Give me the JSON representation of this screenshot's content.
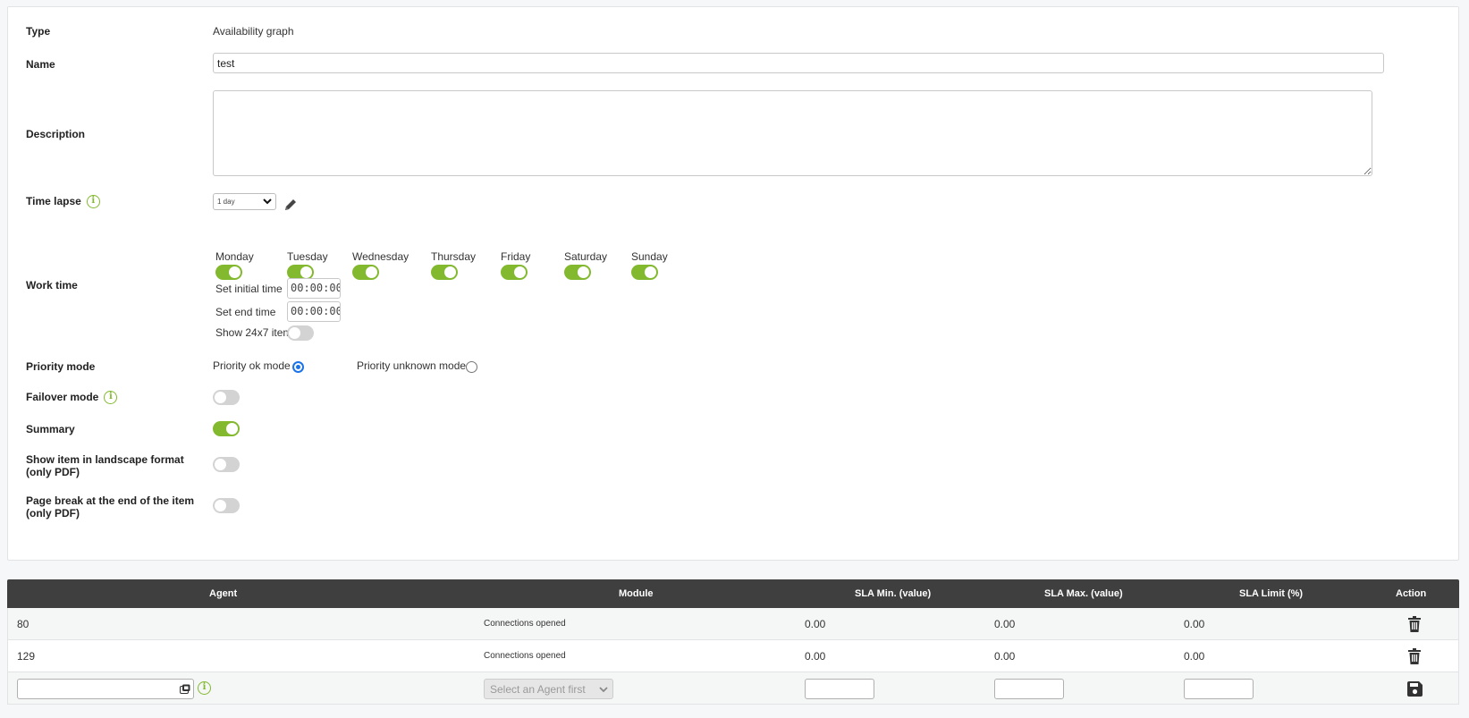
{
  "form": {
    "type_label": "Type",
    "type_value": "Availability graph",
    "name_label": "Name",
    "name_value": "test",
    "description_label": "Description",
    "description_value": "",
    "time_lapse_label": "Time lapse",
    "time_lapse_value": "1 day",
    "work_time_label": "Work time",
    "days": [
      {
        "name": "Monday",
        "on": true
      },
      {
        "name": "Tuesday",
        "on": true
      },
      {
        "name": "Wednesday",
        "on": true
      },
      {
        "name": "Thursday",
        "on": true
      },
      {
        "name": "Friday",
        "on": true
      },
      {
        "name": "Saturday",
        "on": true
      },
      {
        "name": "Sunday",
        "on": true
      }
    ],
    "initial_time_label": "Set initial time",
    "initial_time_value": "00:00:00",
    "end_time_label": "Set end time",
    "end_time_value": "00:00:00",
    "show_24x7_label": "Show 24x7 item",
    "show_24x7_on": false,
    "priority_mode_label": "Priority mode",
    "priority_ok_label": "Priority ok mode",
    "priority_unknown_label": "Priority unknown mode",
    "priority_selected": "ok",
    "failover_mode_label": "Failover mode",
    "failover_on": false,
    "summary_label": "Summary",
    "summary_on": true,
    "landscape_label_line1": "Show item in landscape format",
    "landscape_label_line2": "(only PDF)",
    "landscape_on": false,
    "pagebreak_label_line1": "Page break at the end of the item",
    "pagebreak_label_line2": "(only PDF)",
    "pagebreak_on": false
  },
  "table": {
    "headers": {
      "agent": "Agent",
      "module": "Module",
      "sla_min": "SLA Min. (value)",
      "sla_max": "SLA Max. (value)",
      "sla_limit": "SLA Limit (%)",
      "action": "Action"
    },
    "rows": [
      {
        "agent": "80",
        "module": "Connections opened",
        "sla_min": "0.00",
        "sla_max": "0.00",
        "sla_limit": "0.00"
      },
      {
        "agent": "129",
        "module": "Connections opened",
        "sla_min": "0.00",
        "sla_max": "0.00",
        "sla_limit": "0.00"
      }
    ],
    "new_row": {
      "module_placeholder": "Select an Agent first"
    }
  },
  "icons": {
    "info": "info-icon",
    "edit": "pencil-icon",
    "delete": "trash-icon",
    "save": "floppy-disk-icon",
    "agent_picker": "agent-picker-icon"
  },
  "colors": {
    "accent": "#82b92e",
    "table_header": "#3f3f3f",
    "radio_selected": "#1a73e8"
  }
}
